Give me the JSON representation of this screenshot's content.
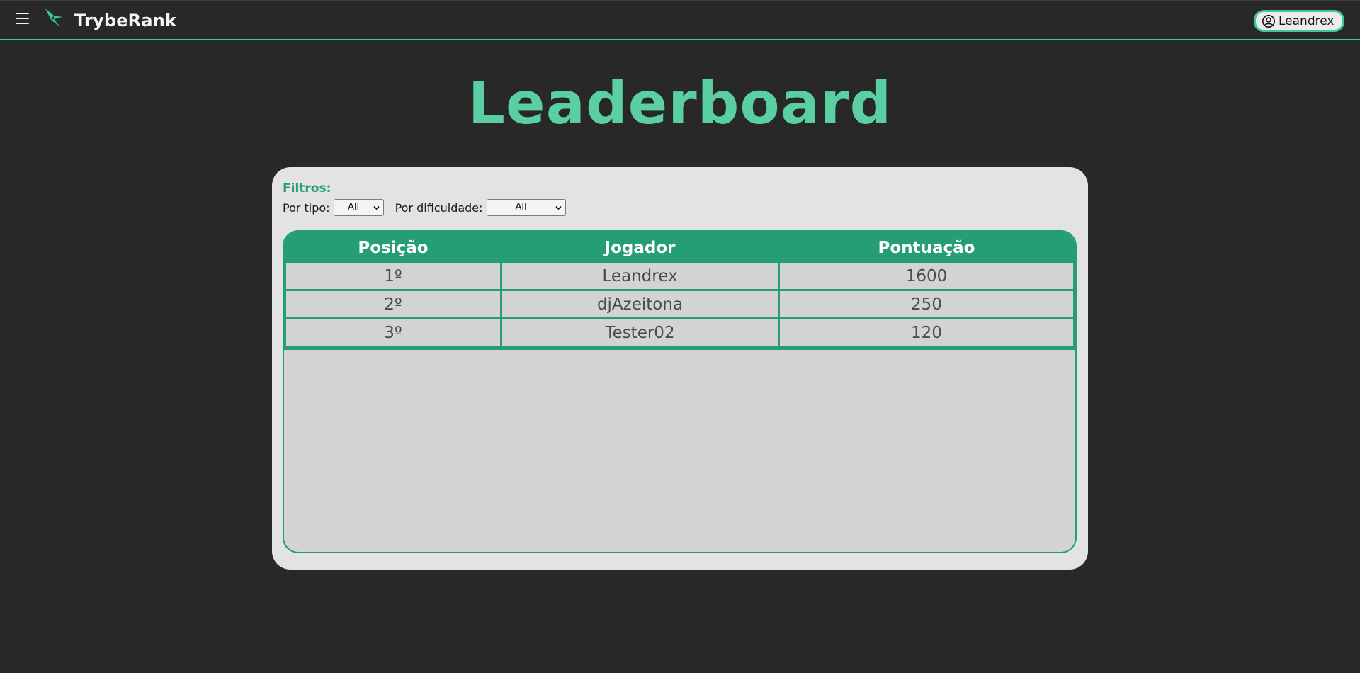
{
  "header": {
    "brand": "TrybeRank",
    "user_label": "Leandrex"
  },
  "page": {
    "title": "Leaderboard"
  },
  "filters": {
    "heading": "Filtros:",
    "type_label": "Por tipo:",
    "type_value": "All",
    "difficulty_label": "Por dificuldade:",
    "difficulty_value": "All"
  },
  "table": {
    "columns": [
      "Posição",
      "Jogador",
      "Pontuação"
    ],
    "rows": [
      {
        "position": "1º",
        "player": "Leandrex",
        "score": "1600"
      },
      {
        "position": "2º",
        "player": "djAzeitona",
        "score": "250"
      },
      {
        "position": "3º",
        "player": "Tester02",
        "score": "120"
      }
    ]
  },
  "colors": {
    "accent": "#59cfa2",
    "table_green": "#259e73",
    "background": "#282828",
    "card": "#e3e3e3"
  },
  "icons": {
    "menu": "hamburger-menu-icon",
    "logo": "trybe-logo-icon",
    "user": "user-circle-icon",
    "select": "chevron-down-icon"
  }
}
